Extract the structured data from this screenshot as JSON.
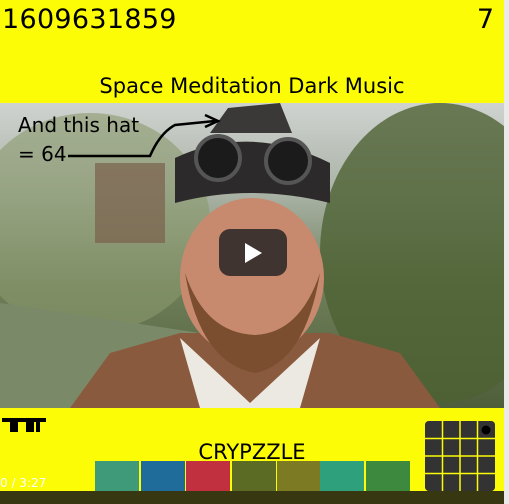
{
  "header": {
    "timestamp": "1609631859",
    "count": "7",
    "title": "Space Meditation Dark Music"
  },
  "annotation": {
    "line1": "And this hat",
    "line2": "= 64"
  },
  "player": {
    "time": "0 / 3:27",
    "play_icon": "play-icon"
  },
  "footer": {
    "brand": "CRYPZZLE",
    "logo_icon": "wave-logo-icon",
    "grid_icon": "puzzle-grid-icon"
  },
  "swatches": [
    "#3e9a78",
    "#1f6b9a",
    "#c0303f",
    "#5b6b23",
    "#7c7a22",
    "#2fa07c",
    "#3d8a3f"
  ],
  "colors": {
    "band": "#fcfc06"
  }
}
